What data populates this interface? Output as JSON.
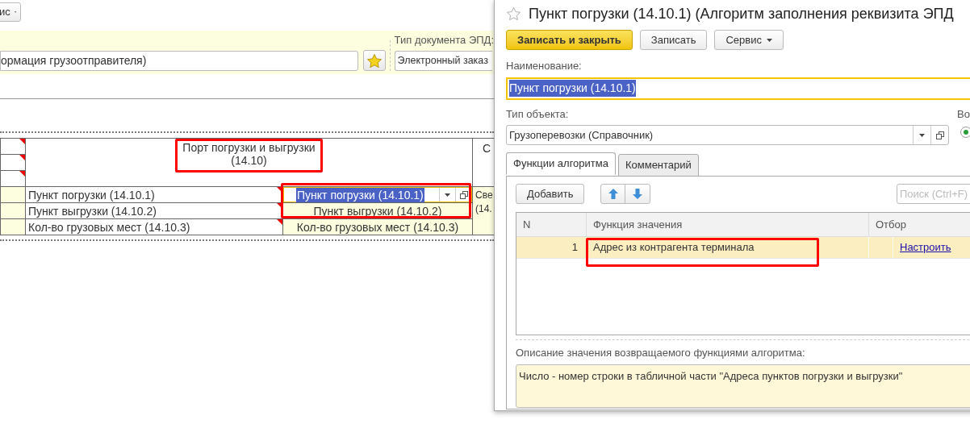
{
  "background_form": {
    "menu_button": "ис",
    "main_field": {
      "value": "ормация грузоотправителя)"
    },
    "doc_type": {
      "label": "Тип документа ЭПД:",
      "value": "Электронный заказ"
    }
  },
  "sheet": {
    "header_lines": [
      "Порт погрузки и выгрузки",
      "(14.10)"
    ],
    "next_header": "С",
    "side_lines": [
      "Све",
      "(14."
    ],
    "rows": [
      {
        "label": "Пункт погрузки (14.10.1)",
        "value": "Пункт погрузки (14.10.1)",
        "selected": true
      },
      {
        "label": "Пункт выгрузки (14.10.2)",
        "value": "Пункт выгрузки (14.10.2)",
        "selected": false
      },
      {
        "label": "Кол-во грузовых мест (14.10.3)",
        "value": "Кол-во грузовых мест (14.10.3)",
        "selected": false
      }
    ]
  },
  "dialog": {
    "title": "Пункт погрузки (14.10.1) (Алгоритм заполнения реквизита ЭПД",
    "buttons": [
      {
        "label": "Записать и закрыть",
        "kind": "primary"
      },
      {
        "label": "Записать",
        "kind": "plain"
      },
      {
        "label": "Сервис",
        "kind": "menu"
      }
    ],
    "name_field": {
      "label": "Наименование:",
      "value": "Пункт погрузки (14.10.1)"
    },
    "object_type": {
      "label": "Тип объекта:",
      "value": "Грузоперевозки (Справочник)"
    },
    "side_label": "Во",
    "radio": {
      "checked": true
    },
    "tabs": [
      {
        "label": "Функции алгоритма",
        "selected": true
      },
      {
        "label": "Комментарий",
        "selected": false
      }
    ],
    "add_button": "Добавить",
    "search": {
      "placeholder": "Поиск (Ctrl+F)"
    },
    "table": {
      "columns": [
        "N",
        "Функция значения",
        "Отбор"
      ],
      "rows": [
        {
          "n": "1",
          "function": "Адрес из контрагента терминала",
          "filter_link": "Настроить",
          "selected": true
        }
      ]
    },
    "description": {
      "label": "Описание значения возвращаемого функциями алгоритма:",
      "value": "Число - номер строки в табличной части \"Адреса пунктов погрузки и выгрузки\""
    }
  }
}
